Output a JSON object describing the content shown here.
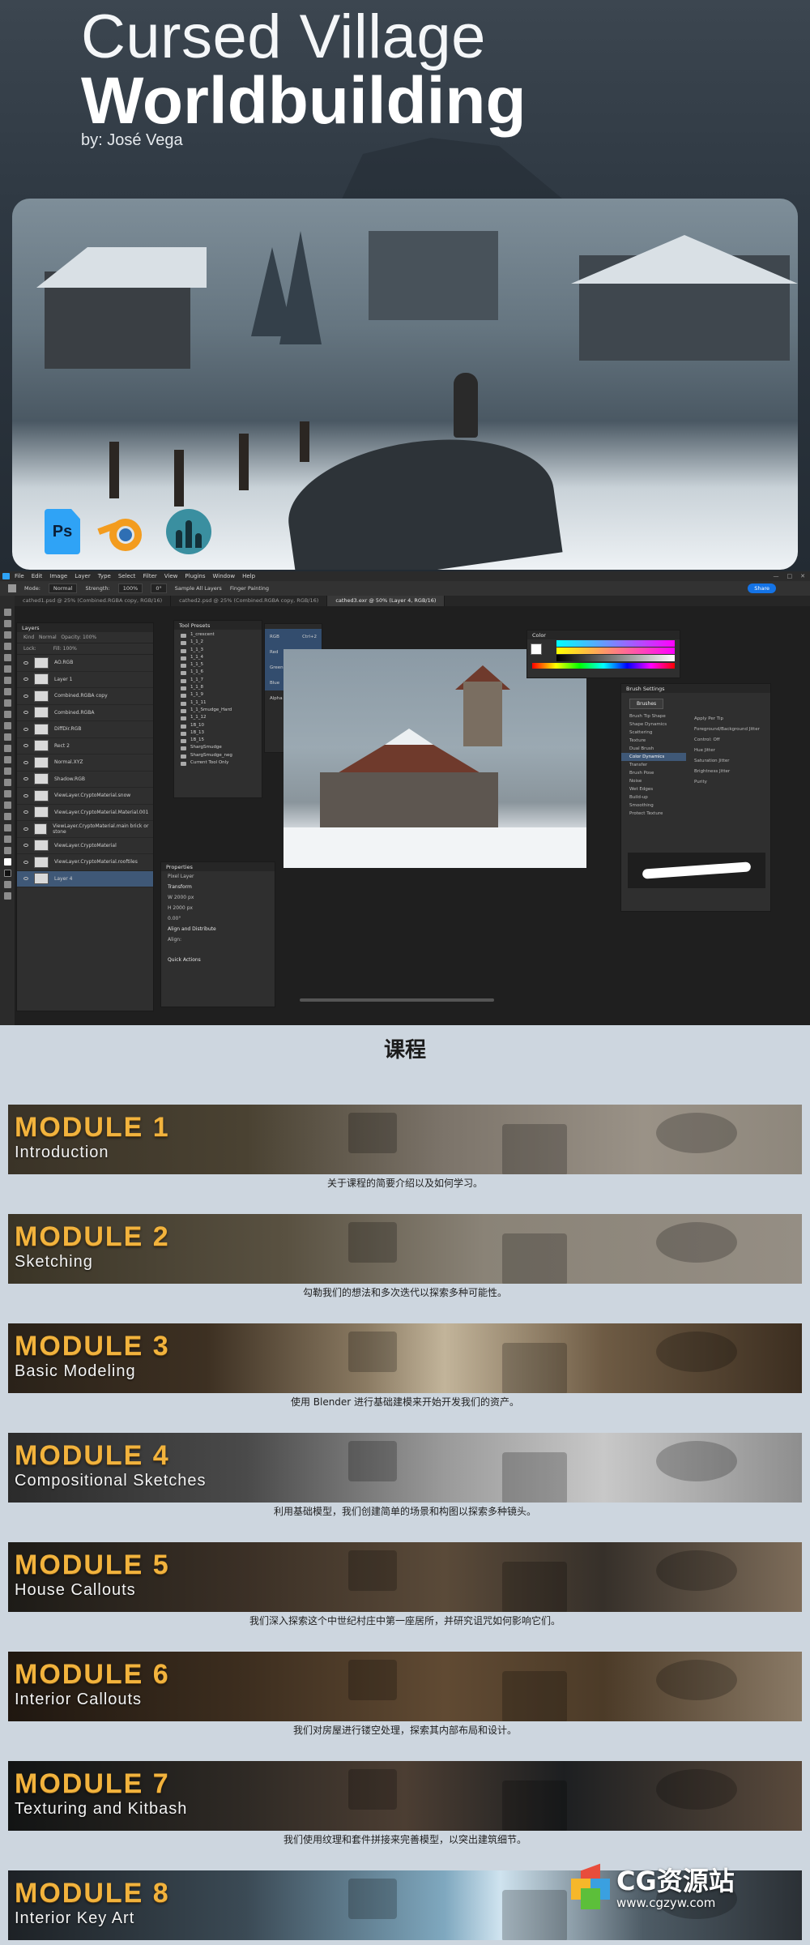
{
  "hero": {
    "title_line1": "Cursed Village",
    "title_line2": "Worldbuilding",
    "author": "by: José Vega",
    "apps": [
      {
        "name": "Photoshop",
        "icon": "photoshop-icon",
        "label": "Ps"
      },
      {
        "name": "Blender",
        "icon": "blender-icon"
      },
      {
        "name": "Substance",
        "icon": "substance-icon"
      }
    ]
  },
  "ps": {
    "menu": [
      "File",
      "Edit",
      "Image",
      "Layer",
      "Type",
      "Select",
      "Filter",
      "View",
      "Plugins",
      "Window",
      "Help"
    ],
    "options": {
      "mode_label": "Mode:",
      "mode_value": "Normal",
      "strength_label": "Strength:",
      "strength_value": "100%",
      "angle_value": "0°",
      "sample_all": "Sample All Layers",
      "finger_painting": "Finger Painting"
    },
    "share_label": "Share",
    "window_controls": [
      "—",
      "□",
      "✕"
    ],
    "tabs": [
      {
        "label": "cathed1.psd @ 25% (Combined.RGBA copy, RGB/16)",
        "active": false
      },
      {
        "label": "cathed2.psd @ 25% (Combined.RGBA copy, RGB/16)",
        "active": false
      },
      {
        "label": "cathed3.exr @ 50% (Layer 4, RGB/16)",
        "active": true
      }
    ],
    "layers_panel": {
      "title": "Layers",
      "filter": "Kind",
      "blend": "Normal",
      "opacity": "Opacity: 100%",
      "lock": "Lock:",
      "fill": "Fill: 100%",
      "rows": [
        "AO.RGB",
        "Layer 1",
        "Combined.RGBA copy",
        "Combined.RGBA",
        "DiffDir.RGB",
        "Rect 2",
        "Normal.XYZ",
        "Shadow.RGB",
        "ViewLayer.CryptoMaterial.snow",
        "ViewLayer.CryptoMaterial.Material.001",
        "ViewLayer.CryptoMaterial.main brick or stone",
        "ViewLayer.CryptoMaterial",
        "ViewLayer.CryptoMaterial.rooftiles",
        "Layer 4"
      ],
      "selected_index": 13
    },
    "tool_presets": {
      "title": "Tool Presets",
      "rows": [
        "1_crescent",
        "1_1_2",
        "1_1_3",
        "1_1_4",
        "1_1_5",
        "1_1_6",
        "1_1_7",
        "1_1_8",
        "1_1_9",
        "1_1_11",
        "1_1_Smudge_Hard",
        "1_1_12",
        "1B_10",
        "1B_13",
        "1B_15",
        "ShargSmudge",
        "ShargSmudge_neg"
      ],
      "current_only": "Current Tool Only"
    },
    "shortcuts": [
      {
        "label": "RGB",
        "key": "Ctrl+2",
        "hl": true
      },
      {
        "label": "Red",
        "key": "Ctrl+3",
        "hl": true
      },
      {
        "label": "Green",
        "key": "Ctrl+4",
        "hl": true
      },
      {
        "label": "Blue",
        "key": "Ctrl+5",
        "hl": true
      },
      {
        "label": "Alpha 1",
        "key": "Ctrl+6",
        "hl": false
      }
    ],
    "properties": {
      "title": "Properties",
      "kind": "Pixel Layer",
      "transform": "Transform",
      "w": "W  2000 px",
      "h": "H  2000 px",
      "angle": "0.00°",
      "align": "Align and Distribute",
      "align_sub": "Align:",
      "quick": "Quick Actions"
    },
    "color_panel": {
      "title": "Color"
    },
    "brush_settings": {
      "title": "Brush Settings",
      "brushes_btn": "Brushes",
      "rows": [
        "Brush Tip Shape",
        "Shape Dynamics",
        "Scattering",
        "Texture",
        "Dual Brush",
        "Color Dynamics",
        "Transfer",
        "Brush Pose",
        "Noise",
        "Wet Edges",
        "Build-up",
        "Smoothing",
        "Protect Texture"
      ],
      "selected_index": 5,
      "right_labels": [
        "Apply Per Tip",
        "Foreground/Background Jitter",
        "Control:  Off",
        "Hue Jitter",
        "Saturation Jitter",
        "Brightness Jitter",
        "Purity"
      ]
    }
  },
  "course": {
    "title": "课程",
    "modules": [
      {
        "title": "MODULE 1",
        "subtitle": "Introduction",
        "desc": "关于课程的简要介绍以及如何学习。"
      },
      {
        "title": "MODULE 2",
        "subtitle": "Sketching",
        "desc": "勾勒我们的想法和多次迭代以探索多种可能性。"
      },
      {
        "title": "MODULE 3",
        "subtitle": "Basic Modeling",
        "desc": "使用 Blender 进行基础建模来开始开发我们的资产。"
      },
      {
        "title": "MODULE 4",
        "subtitle": "Compositional Sketches",
        "desc": "利用基础模型，我们创建简单的场景和构图以探索多种镜头。"
      },
      {
        "title": "MODULE 5",
        "subtitle": "House Callouts",
        "desc": "我们深入探索这个中世纪村庄中第一座居所，并研究诅咒如何影响它们。"
      },
      {
        "title": "MODULE 6",
        "subtitle": "Interior Callouts",
        "desc": "我们对房屋进行镂空处理，探索其内部布局和设计。"
      },
      {
        "title": "MODULE 7",
        "subtitle": "Texturing and Kitbash",
        "desc": "我们使用纹理和套件拼接来完善模型，以突出建筑细节。"
      },
      {
        "title": "MODULE 8",
        "subtitle": "Interior Key Art",
        "desc": ""
      }
    ]
  },
  "watermark": {
    "main": "CG资源站",
    "url": "www.cgzyw.com"
  },
  "colors": {
    "module_title": "#f2b33d",
    "ps_blue": "#2fa3f6",
    "ps_share": "#1473e6",
    "page_bg": "#cdd6df"
  }
}
